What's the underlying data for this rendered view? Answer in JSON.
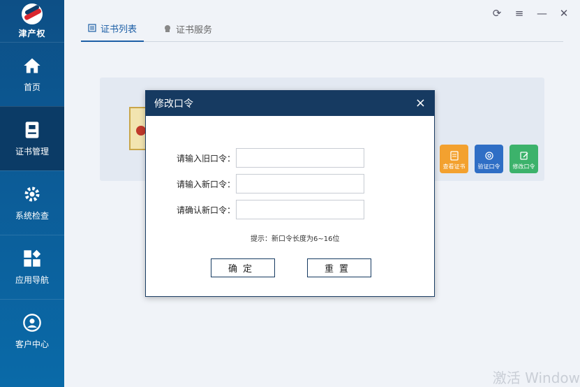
{
  "app": {
    "logo_text": "津产权"
  },
  "sidebar": {
    "items": [
      {
        "label": "首页",
        "icon": "home-icon"
      },
      {
        "label": "证书管理",
        "icon": "certificate-icon",
        "active": true
      },
      {
        "label": "系统检查",
        "icon": "gear-icon"
      },
      {
        "label": "应用导航",
        "icon": "apps-icon"
      },
      {
        "label": "客户中心",
        "icon": "customer-icon"
      }
    ]
  },
  "window_controls": {
    "refresh": "⟳",
    "menu": "≡",
    "minimize": "—",
    "close": "✕"
  },
  "tabs": [
    {
      "label": "证书列表",
      "active": true
    },
    {
      "label": "证书服务",
      "active": false
    }
  ],
  "actions": {
    "view_cert": "查看证书",
    "verify_pin": "验证口令",
    "change_pin": "修改口令"
  },
  "watermark": "激活 Window",
  "dialog": {
    "title": "修改口令",
    "close": "×",
    "fields": {
      "old_label": "请输入旧口令：",
      "new_label": "请输入新口令：",
      "confirm_label": "请确认新口令：",
      "old_value": "",
      "new_value": "",
      "confirm_value": ""
    },
    "hint": "提示：新口令长度为6~16位",
    "ok_label": "确定",
    "reset_label": "重置"
  },
  "colors": {
    "sidebar": "#0d4f86",
    "dialog_header": "#163a61",
    "tab_active": "#1d5fa6",
    "btn_view": "#f3a12f",
    "btn_verify": "#2f6ec5",
    "btn_edit": "#3cb26b"
  }
}
